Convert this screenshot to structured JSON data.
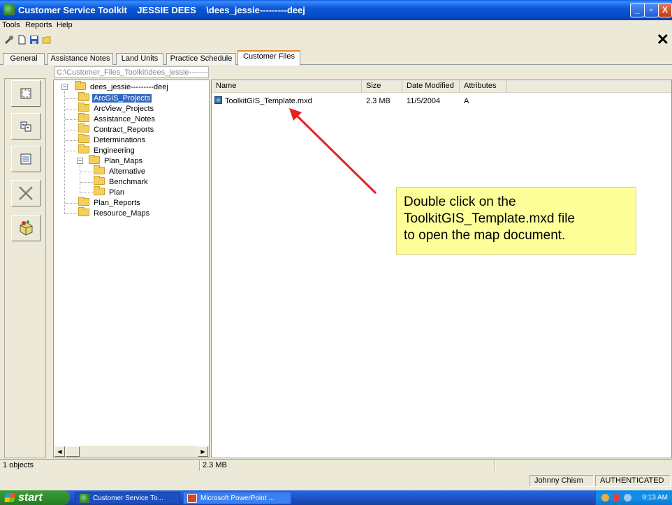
{
  "window": {
    "title": "Customer Service Toolkit    JESSIE DEES    \\dees_jessie---------deej",
    "controls": {
      "minimize": "_",
      "maximize": "▫",
      "close": "X"
    }
  },
  "menu": [
    "Tools",
    "Reports",
    "Help"
  ],
  "toolbar": {
    "close_glyph": "✕"
  },
  "tabs": [
    "General",
    "Assistance Notes",
    "Land Units",
    "Practice Schedule",
    "Customer Files"
  ],
  "active_tab": "Customer Files",
  "path": "C:\\Customer_Files_Toolkit\\dees_jessie---------deej",
  "tree": {
    "root": "dees_jessie---------deej",
    "root_expander": "−",
    "plan_maps_expander": "−",
    "items": [
      {
        "label": "ArcGIS_Projects",
        "selected": true
      },
      {
        "label": "ArcView_Projects"
      },
      {
        "label": "Assistance_Notes"
      },
      {
        "label": "Contract_Reports"
      },
      {
        "label": "Determinations"
      },
      {
        "label": "Engineering"
      },
      {
        "label": "Plan_Maps"
      },
      {
        "label": "Alternative"
      },
      {
        "label": "Benchmark"
      },
      {
        "label": "Plan"
      },
      {
        "label": "Plan_Reports"
      },
      {
        "label": "Resource_Maps"
      }
    ]
  },
  "file_list": {
    "columns": [
      "Name",
      "Size",
      "Date Modified",
      "Attributes"
    ],
    "rows": [
      {
        "name": "ToolkitGIS_Template.mxd",
        "size": "2.3 MB",
        "date": "11/5/2004",
        "attributes": "A"
      }
    ]
  },
  "callout": {
    "lines": [
      "Double click on the",
      "ToolkitGIS_Template.mxd file",
      "to open the map document."
    ],
    "arrow_color": "#e8201a"
  },
  "status": {
    "objects": "1 objects",
    "size": "2.3 MB"
  },
  "status2": {
    "user": "Johnny Chism",
    "auth": "AUTHENTICATED"
  },
  "taskbar": {
    "start": "start",
    "tasks": [
      "Customer Service To...",
      "Microsoft PowerPoint ..."
    ],
    "clock": "9:13 AM"
  }
}
